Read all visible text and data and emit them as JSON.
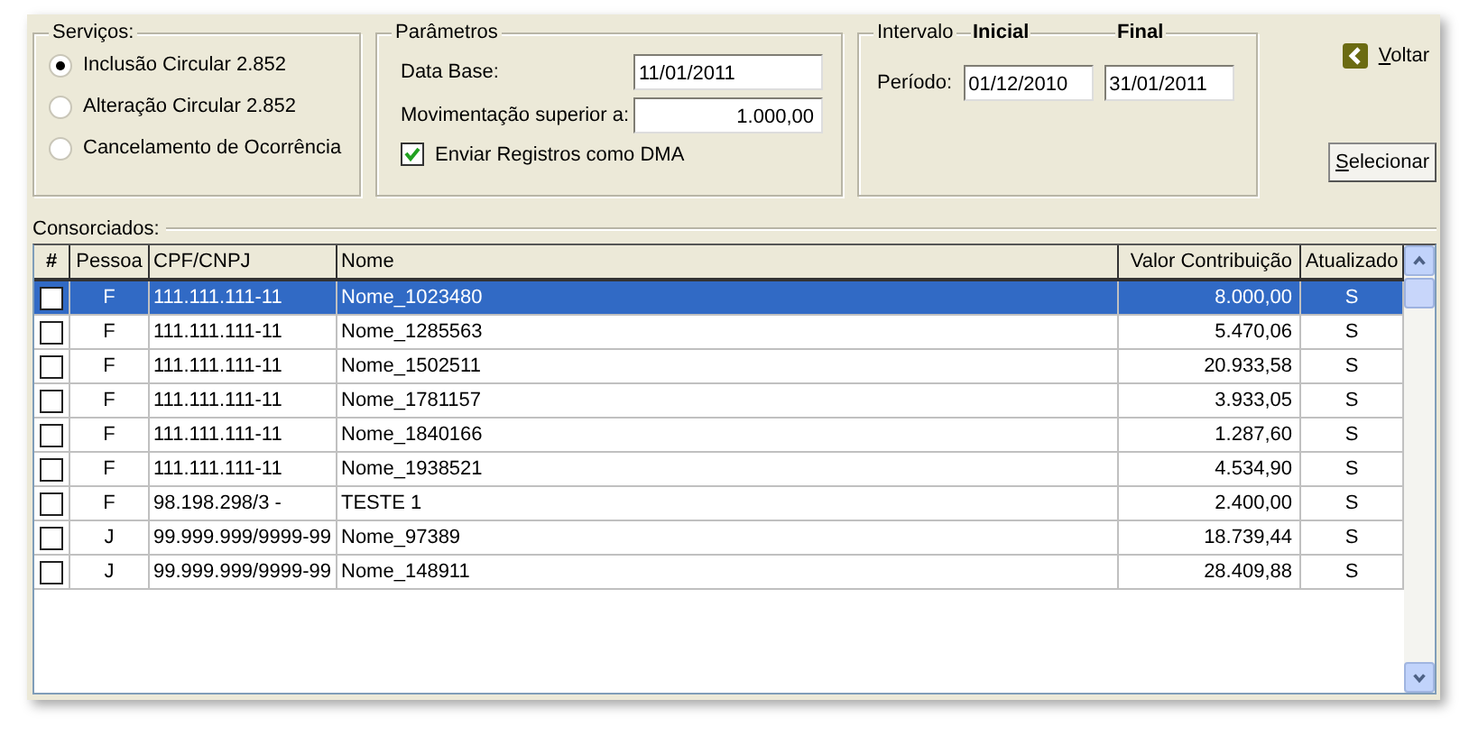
{
  "services": {
    "title": "Serviços:",
    "options": [
      {
        "label": "Inclusão Circular 2.852",
        "selected": true
      },
      {
        "label": "Alteração Circular 2.852",
        "selected": false
      },
      {
        "label": "Cancelamento de Ocorrência",
        "selected": false
      }
    ]
  },
  "parameters": {
    "title": "Parâmetros",
    "fields": [
      {
        "label": "Data Base:",
        "value": "11/01/2011",
        "kind": "date"
      },
      {
        "label": "Movimentação superior a:",
        "value": "1.000,00",
        "kind": "amount"
      }
    ],
    "checkbox": {
      "label": "Enviar Registros como DMA",
      "checked": true
    }
  },
  "interval": {
    "title": "Intervalo",
    "start_label": "Inicial",
    "end_label": "Final",
    "period_label": "Período:",
    "start": "01/12/2010",
    "end": "31/01/2011"
  },
  "back_button": "Voltar",
  "select_button": "Selecionar",
  "consorciados": {
    "label": "Consorciados:",
    "columns": [
      "#",
      "Pessoa",
      "CPF/CNPJ",
      "Nome",
      "Valor Contribuição",
      "Atualizado"
    ],
    "rows": [
      {
        "checked": false,
        "selected": true,
        "pessoa": "F",
        "cpf_cnpj": "111.111.111-11",
        "nome": "Nome_1023480",
        "valor": "8.000,00",
        "atualizado": "S"
      },
      {
        "checked": false,
        "selected": false,
        "pessoa": "F",
        "cpf_cnpj": "111.111.111-11",
        "nome": "Nome_1285563",
        "valor": "5.470,06",
        "atualizado": "S"
      },
      {
        "checked": false,
        "selected": false,
        "pessoa": "F",
        "cpf_cnpj": "111.111.111-11",
        "nome": "Nome_1502511",
        "valor": "20.933,58",
        "atualizado": "S"
      },
      {
        "checked": false,
        "selected": false,
        "pessoa": "F",
        "cpf_cnpj": "111.111.111-11",
        "nome": "Nome_1781157",
        "valor": "3.933,05",
        "atualizado": "S"
      },
      {
        "checked": false,
        "selected": false,
        "pessoa": "F",
        "cpf_cnpj": "111.111.111-11",
        "nome": "Nome_1840166",
        "valor": "1.287,60",
        "atualizado": "S"
      },
      {
        "checked": false,
        "selected": false,
        "pessoa": "F",
        "cpf_cnpj": "111.111.111-11",
        "nome": "Nome_1938521",
        "valor": "4.534,90",
        "atualizado": "S"
      },
      {
        "checked": false,
        "selected": false,
        "pessoa": "F",
        "cpf_cnpj": "98.198.298/3   -",
        "nome": "TESTE 1",
        "valor": "2.400,00",
        "atualizado": "S"
      },
      {
        "checked": false,
        "selected": false,
        "pessoa": "J",
        "cpf_cnpj": "99.999.999/9999-99",
        "nome": "Nome_97389",
        "valor": "18.739,44",
        "atualizado": "S"
      },
      {
        "checked": false,
        "selected": false,
        "pessoa": "J",
        "cpf_cnpj": "99.999.999/9999-99",
        "nome": "Nome_148911",
        "valor": "28.409,88",
        "atualizado": "S"
      }
    ]
  }
}
